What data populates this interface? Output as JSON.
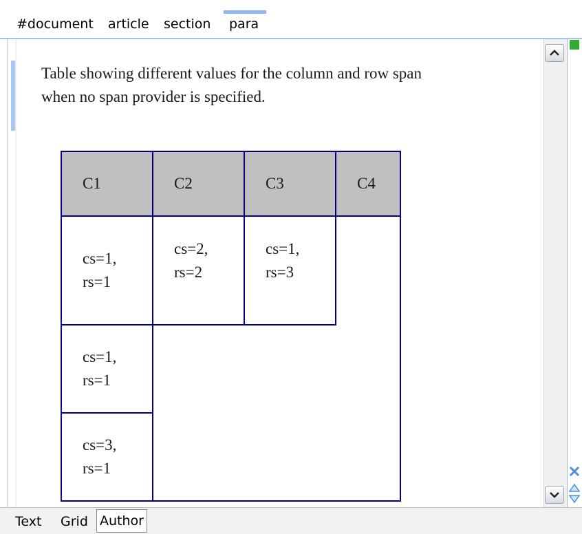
{
  "breadcrumb": {
    "items": [
      "#document",
      "article",
      "section",
      "para"
    ],
    "active": "para"
  },
  "paragraph": {
    "text": "Table showing different values for the column and row span when no span provider is specified."
  },
  "table": {
    "headers": [
      "C1",
      "C2",
      "C3",
      "C4"
    ],
    "cells": {
      "r1c1": [
        "cs=1,",
        "rs=1"
      ],
      "r1c2": [
        "cs=2,",
        "rs=2"
      ],
      "r1c3": [
        "cs=1,",
        "rs=3"
      ],
      "r2c1": [
        "cs=1,",
        "rs=1"
      ],
      "r3c1": [
        "cs=3,",
        "rs=1"
      ]
    }
  },
  "tabs": {
    "items": [
      "Text",
      "Grid",
      "Author"
    ],
    "active": "Author"
  },
  "colors": {
    "table_border": "#000080",
    "header_bg": "#c0c0c0",
    "para_marker": "#a8c6f0",
    "outline_marker": "#33aa33"
  },
  "icons": {
    "scroll_up": "scroll-up-arrow-icon",
    "scroll_down": "scroll-down-arrow-icon",
    "collapse": "collapse-x-icon",
    "navigate": "navigate-up-down-icon"
  }
}
